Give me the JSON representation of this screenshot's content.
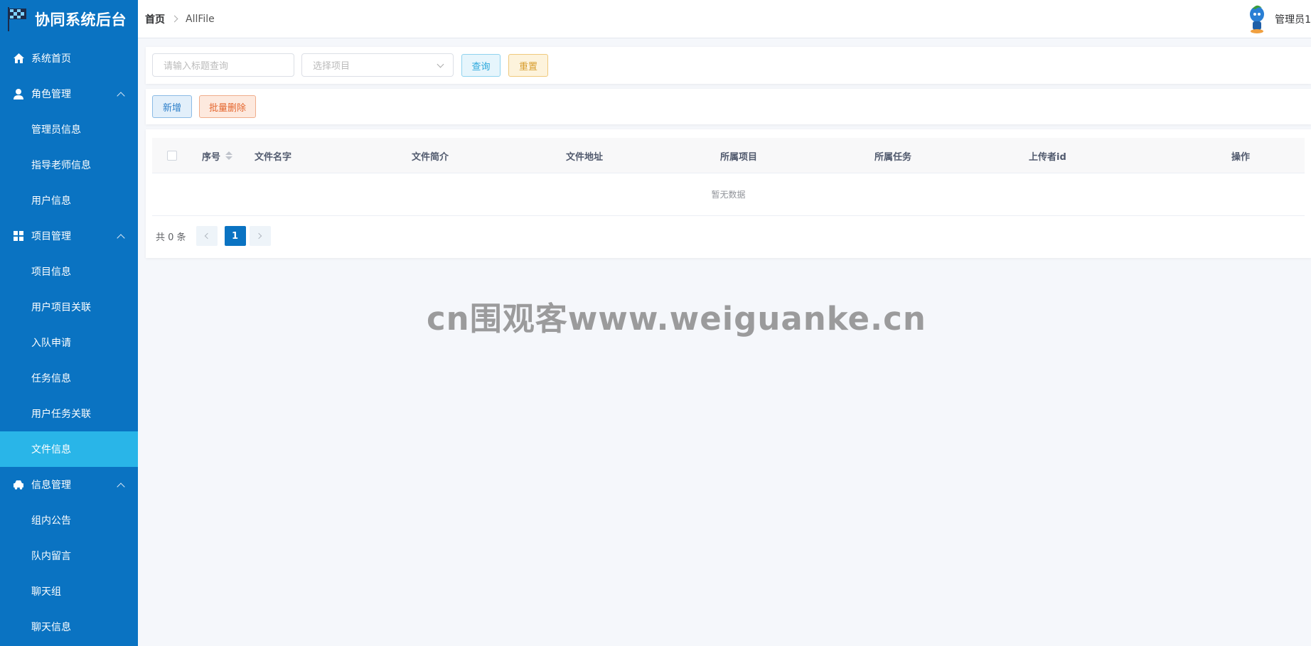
{
  "app": {
    "title": "协同系统后台"
  },
  "sidebar": {
    "items": [
      {
        "label": "系统首页",
        "icon": "home-icon"
      },
      {
        "label": "角色管理",
        "icon": "user-icon",
        "children": [
          "管理员信息",
          "指导老师信息",
          "用户信息"
        ]
      },
      {
        "label": "项目管理",
        "icon": "grid-icon",
        "children": [
          "项目信息",
          "用户项目关联",
          "入队申请",
          "任务信息",
          "用户任务关联",
          "文件信息"
        ]
      },
      {
        "label": "信息管理",
        "icon": "car-icon",
        "children": [
          "组内公告",
          "队内留言",
          "聊天组",
          "聊天信息"
        ]
      }
    ],
    "active": "文件信息"
  },
  "header": {
    "breadcrumb_home": "首页",
    "breadcrumb_current": "AllFile",
    "user_name": "管理员1"
  },
  "search": {
    "title_placeholder": "请输入标题查询",
    "project_placeholder": "选择项目",
    "query_label": "查询",
    "reset_label": "重置"
  },
  "toolbar": {
    "add_label": "新增",
    "batch_delete_label": "批量删除"
  },
  "table": {
    "columns": [
      "序号",
      "文件名字",
      "文件简介",
      "文件地址",
      "所属项目",
      "所属任务",
      "上传者id",
      "操作"
    ],
    "empty_text": "暂无数据"
  },
  "pagination": {
    "total_text": "共 0 条",
    "current_page": "1"
  },
  "watermark": {
    "text": "cn围观客www.weiguanke.cn"
  },
  "colors": {
    "sidebar": "#0a73c2",
    "active": "#29b5e8"
  }
}
